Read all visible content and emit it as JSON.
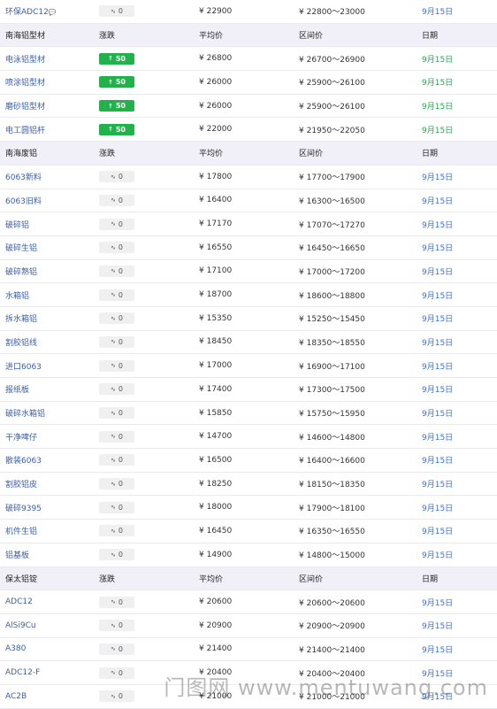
{
  "colors": {
    "link": "#3b5ea7",
    "date_blue": "#3b6fd1",
    "date_green": "#1fa84b",
    "up_badge": "#21b24b",
    "header_bg": "#f1f0f8"
  },
  "rows": [
    {
      "type": "data",
      "name": "环保ADC12",
      "change": "0",
      "dir": "flat",
      "avg": "¥ 22900",
      "range": "¥ 22800～23000",
      "date": "9月15日",
      "date_style": "blue",
      "name_suffix": "💬"
    },
    {
      "type": "header",
      "cols": [
        "南海铝型材",
        "涨跌",
        "平均价",
        "区间价",
        "日期"
      ]
    },
    {
      "type": "data",
      "name": "电泳铝型材",
      "change": "50",
      "dir": "up",
      "avg": "¥ 26800",
      "range": "¥ 26700～26900",
      "date": "9月15日",
      "date_style": "green"
    },
    {
      "type": "data",
      "name": "喷涂铝型材",
      "change": "50",
      "dir": "up",
      "avg": "¥ 26000",
      "range": "¥ 25900～26100",
      "date": "9月15日",
      "date_style": "green"
    },
    {
      "type": "data",
      "name": "磨砂铝型材",
      "change": "50",
      "dir": "up",
      "avg": "¥ 26000",
      "range": "¥ 25900～26100",
      "date": "9月15日",
      "date_style": "green"
    },
    {
      "type": "data",
      "name": "电工圆铝杆",
      "change": "50",
      "dir": "up",
      "avg": "¥ 22000",
      "range": "¥ 21950～22050",
      "date": "9月15日",
      "date_style": "green"
    },
    {
      "type": "header",
      "cols": [
        "南海废铝",
        "涨跌",
        "平均价",
        "区间价",
        "日期"
      ]
    },
    {
      "type": "data",
      "name": "6063新料",
      "change": "0",
      "dir": "flat",
      "avg": "¥ 17800",
      "range": "¥ 17700～17900",
      "date": "9月15日",
      "date_style": "blue"
    },
    {
      "type": "data",
      "name": "6063旧料",
      "change": "0",
      "dir": "flat",
      "avg": "¥ 16400",
      "range": "¥ 16300～16500",
      "date": "9月15日",
      "date_style": "blue"
    },
    {
      "type": "data",
      "name": "破碎铝",
      "change": "0",
      "dir": "flat",
      "avg": "¥ 17170",
      "range": "¥ 17070～17270",
      "date": "9月15日",
      "date_style": "blue"
    },
    {
      "type": "data",
      "name": "破碎生铝",
      "change": "0",
      "dir": "flat",
      "avg": "¥ 16550",
      "range": "¥ 16450～16650",
      "date": "9月15日",
      "date_style": "blue"
    },
    {
      "type": "data",
      "name": "破碎熟铝",
      "change": "0",
      "dir": "flat",
      "avg": "¥ 17100",
      "range": "¥ 17000～17200",
      "date": "9月15日",
      "date_style": "blue"
    },
    {
      "type": "data",
      "name": "水箱铝",
      "change": "0",
      "dir": "flat",
      "avg": "¥ 18700",
      "range": "¥ 18600～18800",
      "date": "9月15日",
      "date_style": "blue"
    },
    {
      "type": "data",
      "name": "拆水箱铝",
      "change": "0",
      "dir": "flat",
      "avg": "¥ 15350",
      "range": "¥ 15250～15450",
      "date": "9月15日",
      "date_style": "blue"
    },
    {
      "type": "data",
      "name": "割胶铝线",
      "change": "0",
      "dir": "flat",
      "avg": "¥ 18450",
      "range": "¥ 18350～18550",
      "date": "9月15日",
      "date_style": "blue"
    },
    {
      "type": "data",
      "name": "进口6063",
      "change": "0",
      "dir": "flat",
      "avg": "¥ 17000",
      "range": "¥ 16900～17100",
      "date": "9月15日",
      "date_style": "blue"
    },
    {
      "type": "data",
      "name": "报纸板",
      "change": "0",
      "dir": "flat",
      "avg": "¥ 17400",
      "range": "¥ 17300～17500",
      "date": "9月15日",
      "date_style": "blue"
    },
    {
      "type": "data",
      "name": "破碎水箱铝",
      "change": "0",
      "dir": "flat",
      "avg": "¥ 15850",
      "range": "¥ 15750～15950",
      "date": "9月15日",
      "date_style": "blue"
    },
    {
      "type": "data",
      "name": "干净啤仔",
      "change": "0",
      "dir": "flat",
      "avg": "¥ 14700",
      "range": "¥ 14600～14800",
      "date": "9月15日",
      "date_style": "blue"
    },
    {
      "type": "data",
      "name": "散装6063",
      "change": "0",
      "dir": "flat",
      "avg": "¥ 16500",
      "range": "¥ 16400～16600",
      "date": "9月15日",
      "date_style": "blue"
    },
    {
      "type": "data",
      "name": "割胶铝皮",
      "change": "0",
      "dir": "flat",
      "avg": "¥ 18250",
      "range": "¥ 18150～18350",
      "date": "9月15日",
      "date_style": "blue"
    },
    {
      "type": "data",
      "name": "破碎9395",
      "change": "0",
      "dir": "flat",
      "avg": "¥ 18000",
      "range": "¥ 17900～18100",
      "date": "9月15日",
      "date_style": "blue"
    },
    {
      "type": "data",
      "name": "机件生铝",
      "change": "0",
      "dir": "flat",
      "avg": "¥ 16450",
      "range": "¥ 16350～16550",
      "date": "9月15日",
      "date_style": "blue"
    },
    {
      "type": "data",
      "name": "铝基板",
      "change": "0",
      "dir": "flat",
      "avg": "¥ 14900",
      "range": "¥ 14800～15000",
      "date": "9月15日",
      "date_style": "blue"
    },
    {
      "type": "header",
      "cols": [
        "保太铝锭",
        "涨跌",
        "平均价",
        "区间价",
        "日期"
      ]
    },
    {
      "type": "data",
      "name": "ADC12",
      "change": "0",
      "dir": "flat",
      "avg": "¥ 20600",
      "range": "¥ 20600～20600",
      "date": "9月15日",
      "date_style": "blue"
    },
    {
      "type": "data",
      "name": "AlSi9Cu",
      "change": "0",
      "dir": "flat",
      "avg": "¥ 20900",
      "range": "¥ 20900～20900",
      "date": "9月15日",
      "date_style": "blue"
    },
    {
      "type": "data",
      "name": "A380",
      "change": "0",
      "dir": "flat",
      "avg": "¥ 21400",
      "range": "¥ 21400～21400",
      "date": "9月15日",
      "date_style": "blue"
    },
    {
      "type": "data",
      "name": "ADC12-F",
      "change": "0",
      "dir": "flat",
      "avg": "¥ 20400",
      "range": "¥ 20400～20400",
      "date": "9月15日",
      "date_style": "blue"
    },
    {
      "type": "data",
      "name": "AC2B",
      "change": "0",
      "dir": "flat",
      "avg": "¥ 21000",
      "range": "¥ 21000～21000",
      "date": "9月15日",
      "date_style": "blue"
    }
  ],
  "watermark": "门图网 www.mentuwang.com"
}
